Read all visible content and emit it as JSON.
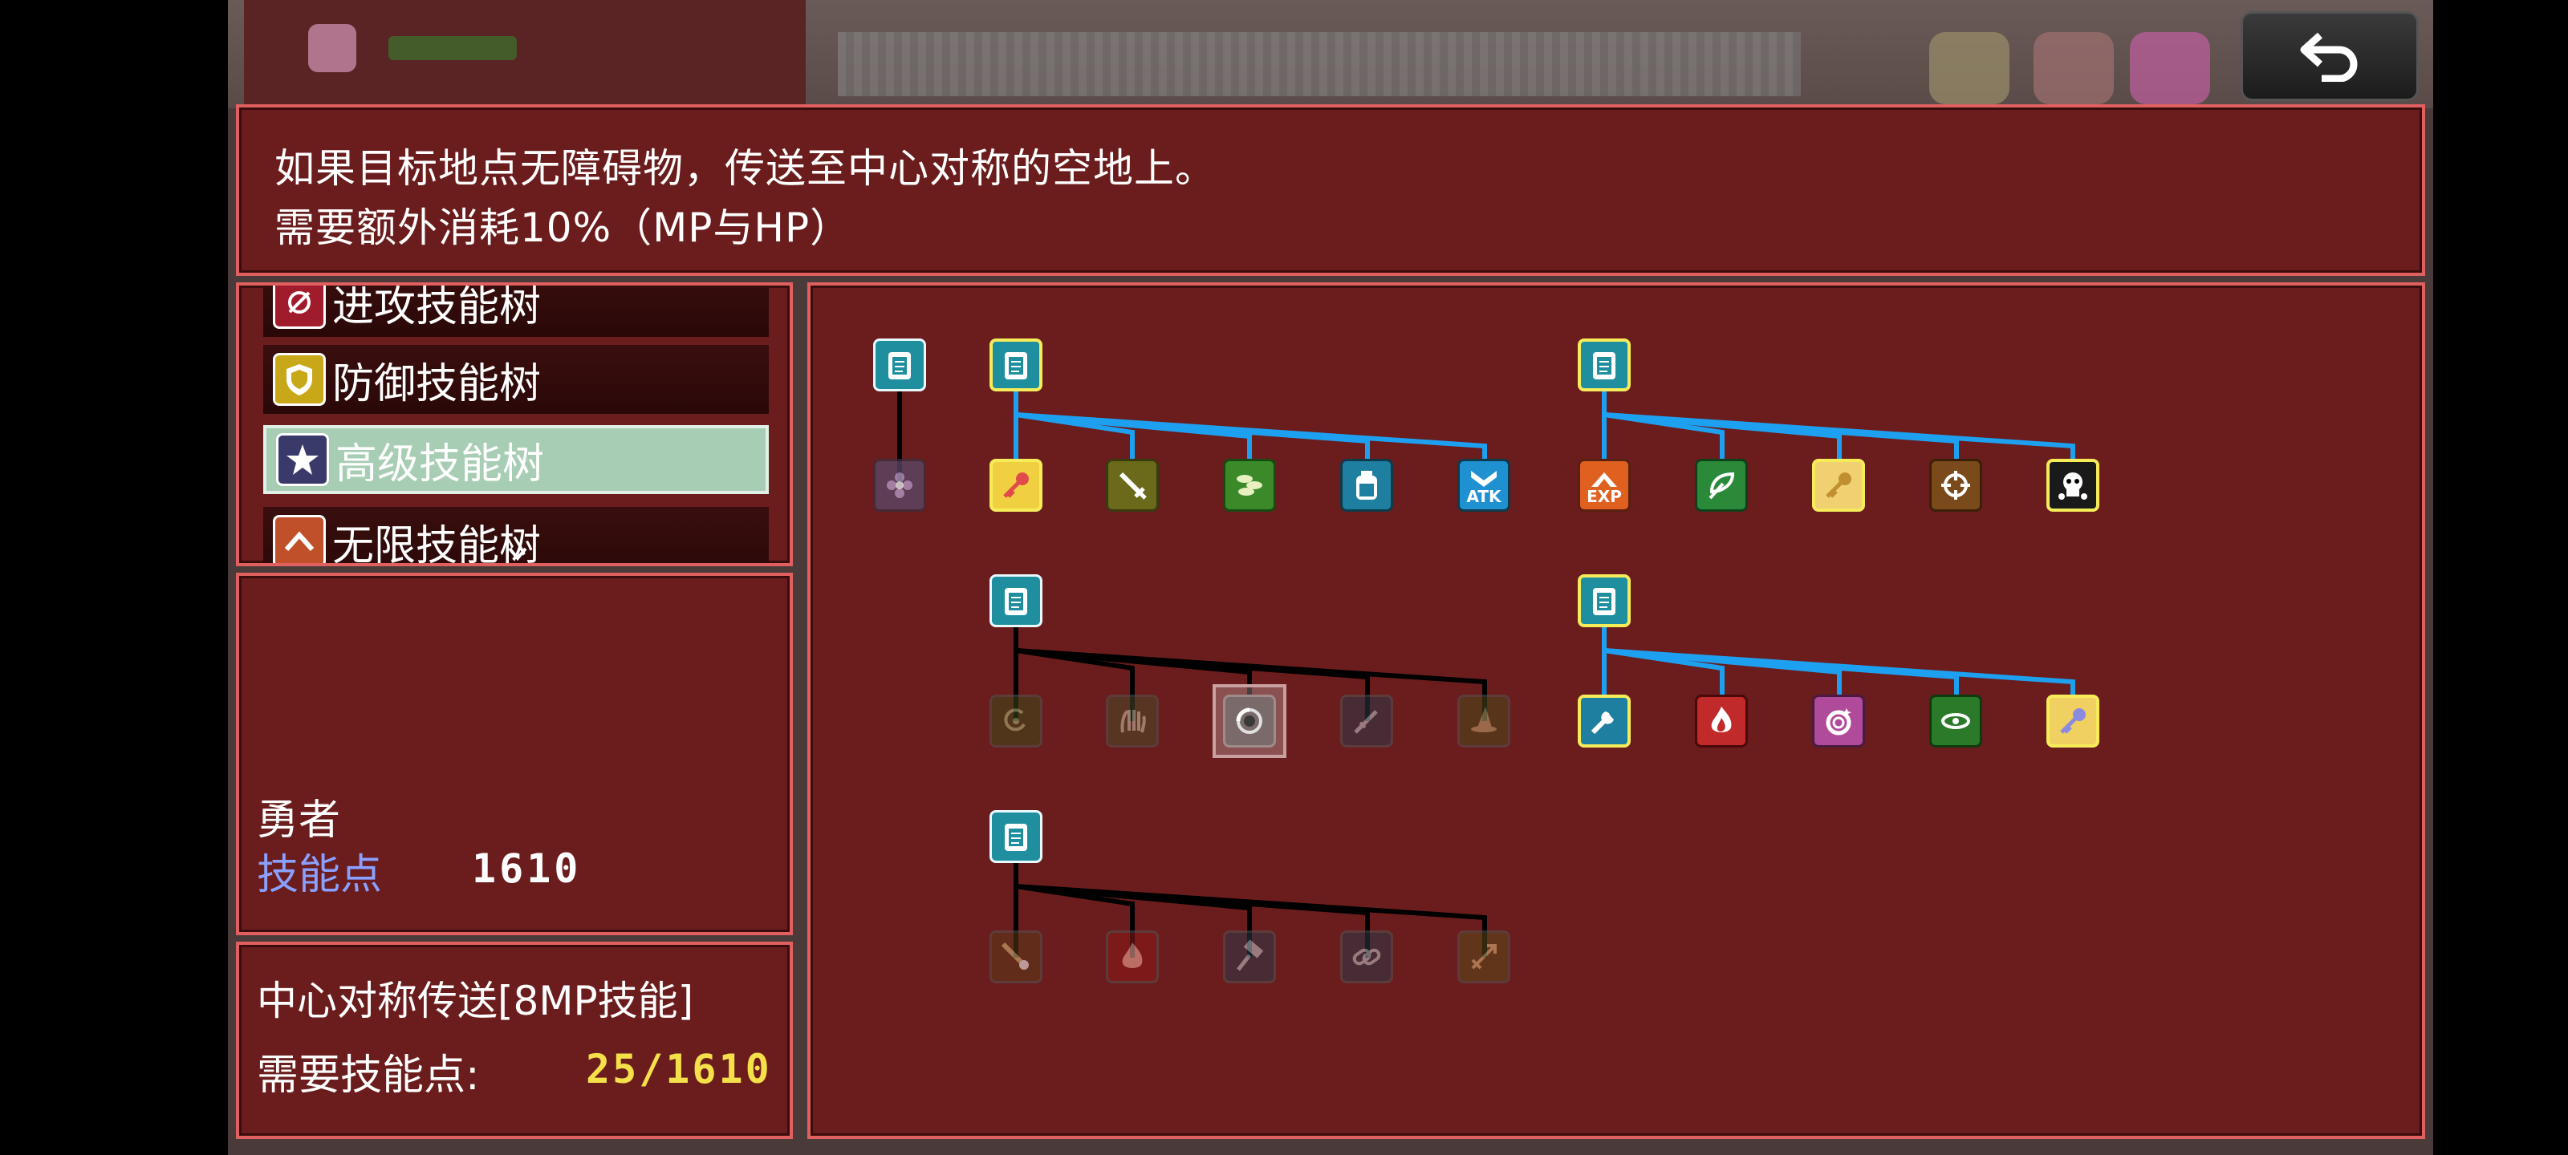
{
  "description": {
    "line1": "如果目标地点无障碍物，传送至中心对称的空地上。",
    "line2": "需要额外消耗10%（MP与HP）"
  },
  "categories": [
    {
      "label": "进攻技能树",
      "icon": "attack-icon",
      "color": "#a01c2c",
      "state": "partial-top"
    },
    {
      "label": "防御技能树",
      "icon": "shield-icon",
      "color": "#c8a818",
      "state": "normal"
    },
    {
      "label": "高级技能树",
      "icon": "star-icon",
      "color": "#3a3a6a",
      "state": "selected"
    },
    {
      "label": "无限技能树",
      "icon": "infinite-icon",
      "color": "#c0502a",
      "state": "partial-bottom"
    }
  ],
  "character": {
    "name": "勇者",
    "skill_points_label": "技能点",
    "skill_points_value": "1610"
  },
  "selected_skill": {
    "title": "中心对称传送[8MP技能]",
    "required_label": "需要技能点:",
    "required_value": "25/1610"
  },
  "tree": {
    "node_labels": {
      "atk": "ATK",
      "exp": "EXP"
    },
    "colors": {
      "active_line": "#1ea0f0",
      "inactive_line": "#000000",
      "highlight_border": "#f6ec5a"
    }
  }
}
